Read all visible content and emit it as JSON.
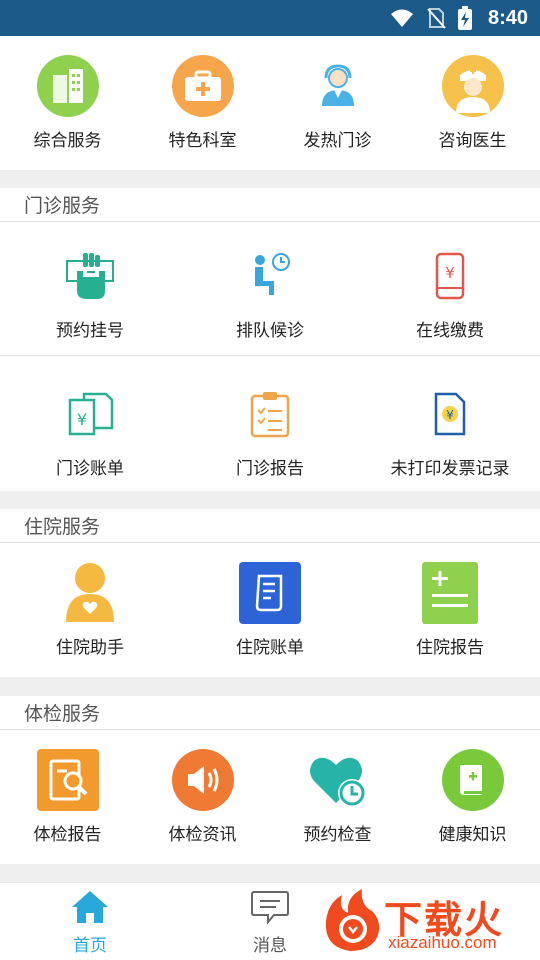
{
  "status_bar": {
    "time": "8:40"
  },
  "top_row": {
    "items": [
      {
        "label": "综合服务",
        "color": "#8fd14f"
      },
      {
        "label": "特色科室",
        "color": "#f6a54b"
      },
      {
        "label": "发热门诊",
        "color": "#4ab2e6"
      },
      {
        "label": "咨询医生",
        "color": "#f6c14a"
      }
    ]
  },
  "outpatient": {
    "title": "门诊服务",
    "items": [
      {
        "label": "预约挂号"
      },
      {
        "label": "排队候诊"
      },
      {
        "label": "在线缴费"
      },
      {
        "label": "门诊账单"
      },
      {
        "label": "门诊报告"
      },
      {
        "label": "未打印发票记录"
      }
    ]
  },
  "inpatient": {
    "title": "住院服务",
    "items": [
      {
        "label": "住院助手",
        "color": "#f5b942"
      },
      {
        "label": "住院账单",
        "color": "#2c64d8"
      },
      {
        "label": "住院报告",
        "color": "#8fd14f"
      }
    ]
  },
  "exam": {
    "title": "体检服务",
    "items": [
      {
        "label": "体检报告",
        "color": "#f39a2e"
      },
      {
        "label": "体检资讯",
        "color": "#f07a33"
      },
      {
        "label": "预约检查",
        "color": "#27b3a8"
      },
      {
        "label": "健康知识",
        "color": "#79c93a"
      }
    ]
  },
  "tab_bar": {
    "tabs": [
      {
        "label": "首页",
        "active": true,
        "color": "#27a8d8"
      },
      {
        "label": "消息",
        "active": false,
        "color": "#555555"
      }
    ]
  },
  "watermark": {
    "brand": "下载火",
    "url": "xiazaihuo.com"
  }
}
